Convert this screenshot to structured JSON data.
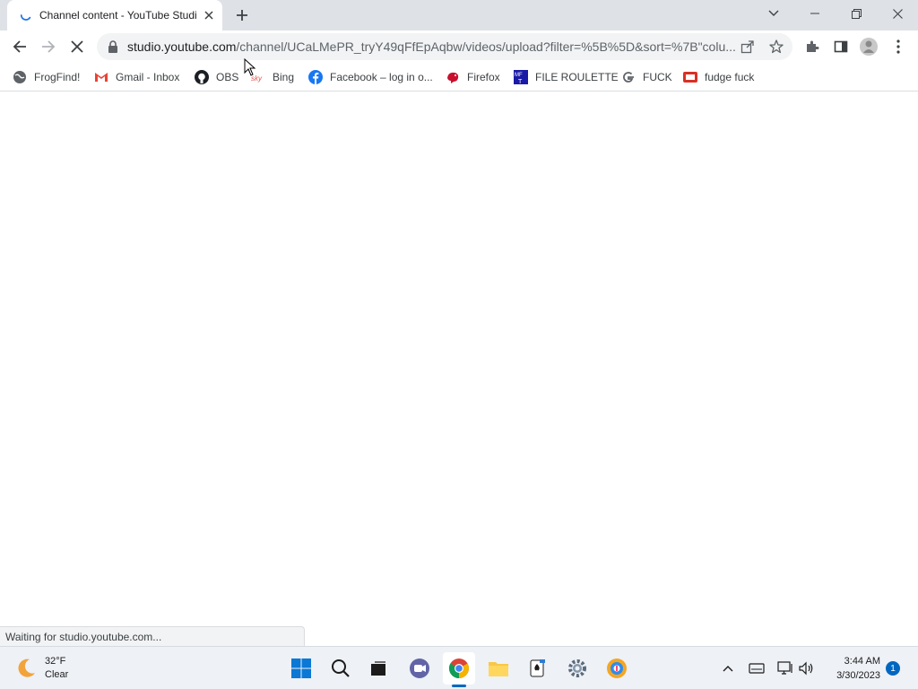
{
  "browser": {
    "tab": {
      "title": "Channel content - YouTube Studio",
      "close_icon": "close-icon",
      "loading_icon": "loading-spinner-icon"
    },
    "new_tab_icon": "plus-icon",
    "window_controls": [
      "chevron-down-icon",
      "minimize-icon",
      "restore-icon",
      "close-icon"
    ],
    "url": {
      "host": "studio.youtube.com",
      "path": "/channel/UCaLMePR_tryY49qFfEpAqbw/videos/upload?filter=%5B%5D&sort=%7B\"colu..."
    },
    "bookmarks": [
      {
        "label": "FrogFind!",
        "icon": "globe-icon"
      },
      {
        "label": "Gmail - Inbox",
        "icon": "gmail-icon"
      },
      {
        "label": "OBS",
        "icon": "github-icon"
      },
      {
        "label": "Bing",
        "icon": "bing-icon"
      },
      {
        "label": "Facebook – log in o...",
        "icon": "facebook-icon"
      },
      {
        "label": "Firefox",
        "icon": "firefox-icon"
      },
      {
        "label": "FILE ROULETTE",
        "icon": "file-roulette-icon"
      },
      {
        "label": "FUCK",
        "icon": "google-icon"
      },
      {
        "label": "fudge fuck",
        "icon": "mail-icon"
      }
    ],
    "status_text": "Waiting for studio.youtube.com..."
  },
  "taskbar": {
    "weather": {
      "temp": "32°F",
      "condition": "Clear"
    },
    "clock": {
      "time": "3:44 AM",
      "date": "3/30/2023"
    },
    "notification_count": "1"
  },
  "colors": {
    "chrome_frame": "#dee1e6",
    "omnibox_bg": "#f1f3f4",
    "accent": "#1a73e8",
    "taskbar_bg": "#eef1f6",
    "win_accent": "#0067c0"
  }
}
